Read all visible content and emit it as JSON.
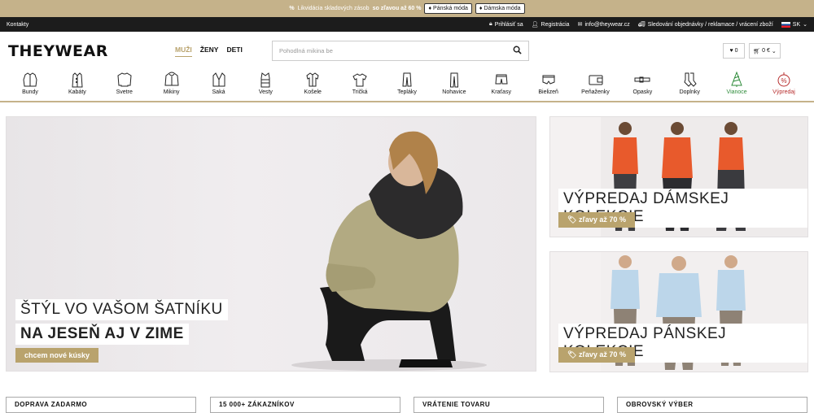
{
  "promo": {
    "percent_icon": "%",
    "text_pre": "Likvidácia skladových zásob",
    "text_bold": "so zľavou až 60 %",
    "btn_men": "Pánská móda",
    "btn_women": "Dámska móda"
  },
  "topbar": {
    "contacts": "Kontakty",
    "login": "Prihlásiť sa",
    "register": "Registrácia",
    "email": "info@theywear.cz",
    "tracking": "Sledování objednávky / reklamace / vrácení zboží",
    "lang": "SK"
  },
  "header": {
    "logo": "THEYWEAR",
    "tabs": [
      "MUŽI",
      "ŽENY",
      "DETI"
    ],
    "search_placeholder": "Pohodlná mikina be",
    "wishlist_count": "0",
    "cart_total": "0 €"
  },
  "categories": [
    {
      "label": "Bundy",
      "icon": "jacket-icon"
    },
    {
      "label": "Kabáty",
      "icon": "coat-icon"
    },
    {
      "label": "Svetre",
      "icon": "sweater-icon"
    },
    {
      "label": "Mikiny",
      "icon": "hoodie-icon"
    },
    {
      "label": "Saká",
      "icon": "blazer-icon"
    },
    {
      "label": "Vesty",
      "icon": "vest-icon"
    },
    {
      "label": "Košele",
      "icon": "shirt-icon"
    },
    {
      "label": "Tričká",
      "icon": "tshirt-icon"
    },
    {
      "label": "Tepláky",
      "icon": "sweatpants-icon"
    },
    {
      "label": "Nohavice",
      "icon": "trousers-icon"
    },
    {
      "label": "Kraťasy",
      "icon": "shorts-icon"
    },
    {
      "label": "Bielizeň",
      "icon": "underwear-icon"
    },
    {
      "label": "Peňaženky",
      "icon": "wallet-icon"
    },
    {
      "label": "Opasky",
      "icon": "belt-icon"
    },
    {
      "label": "Doplnky",
      "icon": "socks-icon"
    },
    {
      "label": "Vianoce",
      "icon": "christmas-tree-icon"
    },
    {
      "label": "Výpredaj",
      "icon": "sale-icon"
    }
  ],
  "hero": {
    "line1": "ŠTÝL VO VAŠOM ŠATNÍKU",
    "line2": "NA JESEŇ AJ V ZIME",
    "cta": "chcem nové kúsky"
  },
  "side_banners": [
    {
      "title": "VÝPREDAJ DÁMSKEJ KOLEKCIE",
      "tag": "zľavy až 70 %"
    },
    {
      "title": "VÝPREDAJ PÁNSKEJ KOLEKCIE",
      "tag": "zľavy až 70 %"
    }
  ],
  "bottom_boxes": [
    "DOPRAVA ZADARMO",
    "15 000+ ZÁKAZNÍKOV",
    "VRÁTENIE TOVARU",
    "OBROVSKÝ VÝBER"
  ],
  "colors": {
    "accent": "#b9a36d",
    "promo_bg": "#c5b28a",
    "topbar_bg": "#1c1c1c"
  }
}
